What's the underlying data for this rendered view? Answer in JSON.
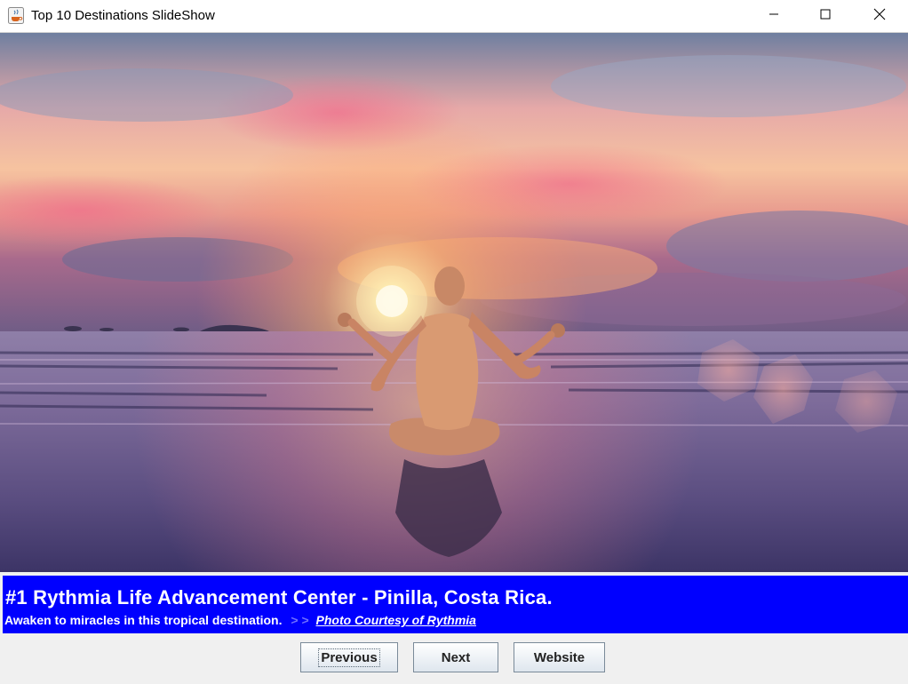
{
  "window": {
    "title": "Top 10 Destinations SlideShow",
    "icon": "java-cup-icon",
    "controls": [
      "minimize-icon",
      "maximize-icon",
      "close-icon"
    ]
  },
  "slide": {
    "image": "sunset beach meditation photo"
  },
  "caption": {
    "title": "#1 Rythmia Life Advancement Center - Pinilla, Costa Rica.",
    "subtitle": "Awaken to miracles in this tropical destination.",
    "separator": "> >",
    "link": "Photo Courtesy of Rythmia",
    "background": "#0000ff"
  },
  "buttons": {
    "previous": "Previous",
    "next": "Next",
    "website": "Website"
  }
}
